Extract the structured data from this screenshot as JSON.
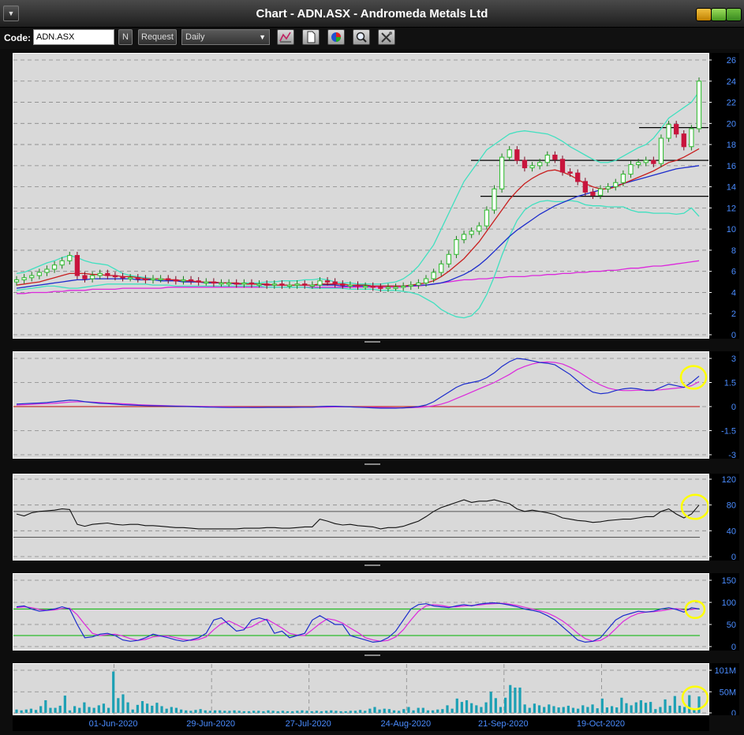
{
  "window": {
    "title": "Chart - ADN.ASX - Andromeda Metals Ltd"
  },
  "toolbar": {
    "code_label": "Code:",
    "code_value": "ADN.ASX",
    "n_button": "N",
    "request_button": "Request",
    "period_selected": "Daily",
    "tool_icons": [
      "chart-settings-icon",
      "document-icon",
      "color-palette-icon",
      "zoom-icon",
      "tools-icon"
    ]
  },
  "colors": {
    "panel_bg": "#d9d9d9",
    "up_candle": "#38c038",
    "down_candle": "#c8143c",
    "upper_band": "#40e0c0",
    "ma_short": "#c81e1e",
    "ma_mid": "#1c2ccc",
    "ma_long": "#dc28dc",
    "signal_line": "#c83232",
    "volume_bar": "#1ca0b4",
    "highlight_circle": "#ffff00",
    "level_green": "#00b400"
  },
  "chart_data": [
    {
      "type": "candlestick",
      "panel": "price",
      "y_ticks": [
        "26",
        "24",
        "22",
        "20",
        "18",
        "16",
        "14",
        "12",
        "10",
        "8",
        "6",
        "4",
        "2",
        "0"
      ],
      "ylim": [
        0,
        26
      ],
      "horizontal_levels": [
        19.6,
        16.5,
        13.1
      ],
      "close": [
        5.2,
        5.4,
        5.6,
        5.9,
        6.2,
        6.6,
        7.0,
        7.5,
        5.6,
        5.3,
        5.6,
        5.8,
        5.6,
        5.5,
        5.4,
        5.4,
        5.3,
        5.2,
        5.3,
        5.3,
        5.2,
        5.1,
        5.2,
        5.1,
        5.0,
        5.0,
        4.9,
        4.9,
        4.9,
        4.8,
        4.9,
        4.8,
        4.8,
        4.7,
        4.8,
        4.7,
        4.7,
        4.8,
        4.7,
        4.7,
        5.1,
        5.0,
        4.8,
        4.7,
        4.7,
        4.6,
        4.6,
        4.5,
        4.4,
        4.5,
        4.5,
        4.6,
        4.7,
        4.9,
        5.3,
        5.9,
        6.7,
        7.6,
        9.0,
        9.5,
        9.8,
        10.3,
        11.8,
        13.8,
        16.8,
        17.5,
        16.5,
        15.8,
        16.0,
        16.3,
        17.0,
        16.6,
        15.4,
        15.3,
        14.5,
        13.5,
        13.2,
        13.8,
        14.0,
        14.4,
        15.2,
        16.1,
        16.3,
        16.5,
        16.2,
        18.6,
        19.9,
        19.0,
        17.8,
        19.5,
        24.0
      ],
      "upper_band": [
        5.8,
        5.9,
        6.2,
        6.5,
        6.8,
        7.0,
        7.3,
        7.5,
        7.3,
        7.0,
        6.8,
        6.7,
        6.6,
        6.2,
        5.8,
        5.6,
        5.5,
        5.4,
        5.3,
        5.3,
        5.2,
        5.1,
        5.1,
        5.0,
        5.0,
        5.0,
        4.9,
        4.9,
        4.9,
        4.8,
        4.9,
        4.9,
        4.9,
        5.0,
        5.0,
        5.1,
        5.1,
        5.1,
        5.2,
        5.2,
        5.3,
        5.2,
        5.0,
        4.9,
        4.9,
        4.8,
        4.8,
        4.8,
        4.8,
        4.9,
        5.0,
        5.3,
        5.8,
        6.5,
        7.5,
        8.5,
        10.0,
        11.5,
        13.0,
        14.5,
        15.5,
        16.5,
        17.5,
        18.0,
        18.5,
        19.0,
        19.2,
        19.3,
        19.2,
        19.1,
        19.0,
        18.7,
        18.3,
        17.8,
        17.4,
        17.0,
        16.6,
        16.3,
        16.3,
        16.5,
        16.9,
        17.3,
        17.7,
        18.0,
        18.6,
        19.5,
        20.5,
        21.0,
        21.5,
        22.0,
        23.0
      ],
      "lower_band": [
        4.2,
        4.3,
        4.4,
        4.5,
        4.6,
        4.6,
        4.5,
        4.4,
        4.4,
        4.5,
        4.6,
        4.7,
        4.8,
        4.8,
        4.8,
        4.8,
        4.8,
        4.8,
        4.7,
        4.7,
        4.7,
        4.6,
        4.6,
        4.6,
        4.6,
        4.6,
        4.6,
        4.6,
        4.6,
        4.6,
        4.6,
        4.6,
        4.6,
        4.5,
        4.5,
        4.5,
        4.5,
        4.5,
        4.5,
        4.4,
        4.4,
        4.4,
        4.4,
        4.4,
        4.3,
        4.3,
        4.3,
        4.3,
        4.2,
        4.2,
        4.2,
        4.1,
        4.0,
        3.8,
        3.4,
        3.0,
        2.4,
        2.0,
        1.7,
        1.6,
        1.8,
        2.5,
        3.8,
        5.5,
        7.5,
        9.3,
        10.8,
        11.8,
        12.3,
        12.6,
        12.7,
        12.6,
        12.6,
        12.7,
        12.6,
        12.3,
        12.2,
        12.2,
        12.1,
        12.1,
        12.1,
        11.8,
        11.6,
        11.6,
        11.5,
        11.5,
        11.5,
        11.4,
        11.5,
        12.0,
        11.2
      ],
      "ma_short": [
        4.7,
        4.8,
        4.9,
        5.0,
        5.2,
        5.4,
        5.6,
        5.8,
        5.8,
        5.8,
        5.7,
        5.7,
        5.6,
        5.6,
        5.5,
        5.5,
        5.4,
        5.3,
        5.3,
        5.3,
        5.2,
        5.2,
        5.1,
        5.1,
        5.0,
        5.0,
        5.0,
        4.9,
        4.9,
        4.9,
        4.8,
        4.8,
        4.8,
        4.8,
        4.7,
        4.7,
        4.7,
        4.7,
        4.7,
        4.7,
        4.8,
        4.8,
        4.8,
        4.8,
        4.7,
        4.7,
        4.7,
        4.6,
        4.6,
        4.6,
        4.6,
        4.6,
        4.7,
        4.8,
        4.9,
        5.1,
        5.5,
        6.0,
        6.6,
        7.2,
        8.0,
        8.8,
        9.8,
        10.8,
        11.8,
        12.8,
        13.6,
        14.3,
        14.8,
        15.2,
        15.5,
        15.6,
        15.4,
        15.1,
        14.7,
        14.3,
        14.0,
        13.8,
        13.8,
        14.0,
        14.3,
        14.6,
        14.9,
        15.2,
        15.5,
        15.9,
        16.3,
        16.5,
        16.8,
        17.2,
        17.6
      ],
      "ma_mid": [
        4.4,
        4.5,
        4.6,
        4.7,
        4.8,
        4.9,
        5.0,
        5.1,
        5.2,
        5.2,
        5.3,
        5.3,
        5.3,
        5.3,
        5.3,
        5.3,
        5.2,
        5.2,
        5.2,
        5.1,
        5.1,
        5.1,
        5.0,
        5.0,
        5.0,
        4.9,
        4.9,
        4.9,
        4.9,
        4.8,
        4.8,
        4.8,
        4.8,
        4.7,
        4.7,
        4.7,
        4.7,
        4.7,
        4.7,
        4.7,
        4.7,
        4.7,
        4.7,
        4.6,
        4.6,
        4.6,
        4.6,
        4.6,
        4.6,
        4.6,
        4.6,
        4.6,
        4.6,
        4.7,
        4.7,
        4.8,
        4.9,
        5.1,
        5.4,
        5.7,
        6.1,
        6.6,
        7.2,
        7.9,
        8.6,
        9.3,
        9.9,
        10.4,
        10.9,
        11.4,
        11.8,
        12.2,
        12.5,
        12.8,
        13.1,
        13.3,
        13.5,
        13.7,
        13.9,
        14.1,
        14.3,
        14.5,
        14.7,
        14.9,
        15.1,
        15.3,
        15.5,
        15.7,
        15.8,
        15.9,
        16.0
      ],
      "ma_long": [
        3.9,
        3.9,
        4.0,
        4.0,
        4.0,
        4.1,
        4.1,
        4.2,
        4.2,
        4.2,
        4.3,
        4.3,
        4.3,
        4.3,
        4.4,
        4.4,
        4.4,
        4.4,
        4.4,
        4.4,
        4.5,
        4.5,
        4.5,
        4.5,
        4.5,
        4.5,
        4.5,
        4.5,
        4.5,
        4.5,
        4.5,
        4.5,
        4.5,
        4.5,
        4.5,
        4.5,
        4.5,
        4.5,
        4.5,
        4.5,
        4.5,
        4.5,
        4.5,
        4.5,
        4.5,
        4.5,
        4.5,
        4.5,
        4.5,
        4.5,
        4.5,
        4.5,
        4.6,
        4.6,
        4.7,
        4.8,
        4.9,
        5.0,
        5.1,
        5.2,
        5.2,
        5.3,
        5.3,
        5.4,
        5.4,
        5.5,
        5.5,
        5.5,
        5.6,
        5.6,
        5.7,
        5.7,
        5.8,
        5.8,
        5.9,
        5.9,
        6.0,
        6.0,
        6.1,
        6.1,
        6.2,
        6.3,
        6.3,
        6.4,
        6.5,
        6.5,
        6.6,
        6.7,
        6.8,
        6.9,
        7.0
      ]
    },
    {
      "type": "line",
      "panel": "macd",
      "y_ticks": [
        "3",
        "1.5",
        "0",
        "-1.5",
        "-3"
      ],
      "ylim": [
        -3,
        3
      ],
      "macd": [
        0.15,
        0.18,
        0.2,
        0.22,
        0.25,
        0.3,
        0.35,
        0.4,
        0.38,
        0.3,
        0.25,
        0.2,
        0.18,
        0.15,
        0.12,
        0.1,
        0.08,
        0.06,
        0.05,
        0.04,
        0.03,
        0.02,
        0.01,
        0.0,
        -0.02,
        -0.03,
        -0.04,
        -0.05,
        -0.06,
        -0.06,
        -0.06,
        -0.06,
        -0.06,
        -0.05,
        -0.05,
        -0.05,
        -0.05,
        -0.04,
        -0.04,
        -0.04,
        0.0,
        0.02,
        0.02,
        0.0,
        -0.02,
        -0.04,
        -0.06,
        -0.08,
        -0.1,
        -0.1,
        -0.1,
        -0.08,
        -0.05,
        0.0,
        0.1,
        0.3,
        0.6,
        0.9,
        1.2,
        1.4,
        1.5,
        1.6,
        1.8,
        2.1,
        2.5,
        2.8,
        3.0,
        2.95,
        2.85,
        2.75,
        2.7,
        2.6,
        2.3,
        2.0,
        1.6,
        1.2,
        0.9,
        0.8,
        0.85,
        1.0,
        1.1,
        1.15,
        1.1,
        1.0,
        1.0,
        1.2,
        1.4,
        1.3,
        1.2,
        1.5,
        1.9
      ],
      "signal": [
        0.1,
        0.12,
        0.14,
        0.16,
        0.18,
        0.2,
        0.24,
        0.28,
        0.3,
        0.3,
        0.28,
        0.25,
        0.22,
        0.2,
        0.17,
        0.15,
        0.12,
        0.1,
        0.08,
        0.07,
        0.05,
        0.04,
        0.03,
        0.02,
        0.01,
        0.0,
        -0.01,
        -0.02,
        -0.03,
        -0.04,
        -0.04,
        -0.05,
        -0.05,
        -0.05,
        -0.05,
        -0.05,
        -0.05,
        -0.05,
        -0.04,
        -0.04,
        -0.04,
        -0.03,
        -0.02,
        -0.02,
        -0.02,
        -0.03,
        -0.04,
        -0.05,
        -0.06,
        -0.07,
        -0.08,
        -0.08,
        -0.07,
        -0.05,
        -0.02,
        0.05,
        0.15,
        0.3,
        0.5,
        0.7,
        0.9,
        1.1,
        1.3,
        1.5,
        1.75,
        2.0,
        2.3,
        2.5,
        2.65,
        2.75,
        2.78,
        2.75,
        2.65,
        2.45,
        2.2,
        1.9,
        1.6,
        1.35,
        1.15,
        1.05,
        1.0,
        1.0,
        1.02,
        1.03,
        1.03,
        1.05,
        1.1,
        1.15,
        1.2,
        1.3,
        1.55
      ],
      "zero_line": 0
    },
    {
      "type": "line",
      "panel": "rsi",
      "y_ticks": [
        "120",
        "80",
        "40",
        "0"
      ],
      "ylim": [
        0,
        120
      ],
      "reference_levels": [
        70,
        30
      ],
      "values": [
        66,
        63,
        68,
        70,
        71,
        72,
        74,
        73,
        50,
        47,
        50,
        51,
        52,
        50,
        49,
        50,
        50,
        48,
        48,
        47,
        46,
        45,
        45,
        44,
        43,
        43,
        43,
        43,
        43,
        43,
        44,
        44,
        44,
        45,
        45,
        44,
        44,
        45,
        46,
        46,
        58,
        55,
        51,
        49,
        50,
        48,
        47,
        46,
        43,
        45,
        45,
        47,
        51,
        55,
        62,
        70,
        76,
        80,
        84,
        88,
        84,
        86,
        86,
        88,
        85,
        82,
        74,
        70,
        72,
        70,
        68,
        65,
        60,
        58,
        56,
        55,
        53,
        54,
        56,
        57,
        58,
        58,
        60,
        62,
        62,
        70,
        74,
        66,
        60,
        66,
        80
      ]
    },
    {
      "type": "line",
      "panel": "stochastic",
      "y_ticks": [
        "150",
        "100",
        "50",
        "0"
      ],
      "ylim": [
        0,
        150
      ],
      "reference_levels": [
        85,
        25
      ],
      "k": [
        90,
        92,
        85,
        80,
        82,
        85,
        90,
        85,
        50,
        20,
        22,
        28,
        30,
        25,
        15,
        12,
        14,
        20,
        28,
        24,
        20,
        15,
        12,
        15,
        20,
        30,
        60,
        65,
        50,
        35,
        38,
        60,
        65,
        60,
        30,
        35,
        20,
        25,
        30,
        60,
        70,
        60,
        50,
        50,
        25,
        20,
        15,
        10,
        12,
        20,
        35,
        60,
        85,
        95,
        97,
        92,
        90,
        88,
        92,
        95,
        92,
        96,
        98,
        99,
        97,
        94,
        90,
        85,
        82,
        78,
        70,
        60,
        45,
        30,
        15,
        10,
        12,
        20,
        40,
        60,
        70,
        75,
        80,
        78,
        80,
        85,
        88,
        84,
        78,
        88,
        85
      ],
      "d": [
        88,
        90,
        88,
        84,
        82,
        83,
        86,
        87,
        72,
        50,
        30,
        25,
        27,
        28,
        24,
        18,
        14,
        16,
        22,
        24,
        24,
        20,
        16,
        14,
        16,
        22,
        38,
        52,
        58,
        50,
        41,
        45,
        55,
        62,
        52,
        42,
        30,
        26,
        25,
        38,
        52,
        63,
        60,
        53,
        42,
        32,
        20,
        15,
        12,
        14,
        22,
        38,
        60,
        80,
        92,
        95,
        93,
        90,
        90,
        92,
        93,
        94,
        96,
        97,
        98,
        96,
        93,
        89,
        85,
        81,
        76,
        68,
        58,
        45,
        30,
        18,
        12,
        14,
        24,
        40,
        57,
        68,
        75,
        78,
        79,
        81,
        84,
        86,
        83,
        84,
        86
      ]
    },
    {
      "type": "bar",
      "panel": "volume",
      "y_ticks": [
        "101M",
        "50M",
        "0"
      ],
      "ylim": [
        0,
        101
      ],
      "x_ticks": [
        "01-Jun-2020",
        "29-Jun-2020",
        "27-Jul-2020",
        "24-Aug-2020",
        "21-Sep-2020",
        "19-Oct-2020"
      ],
      "x_tick_indices": [
        20,
        40,
        60,
        80,
        100,
        120
      ],
      "values": [
        8,
        6,
        8,
        10,
        7,
        16,
        30,
        12,
        12,
        17,
        41,
        6,
        16,
        12,
        25,
        14,
        12,
        18,
        22,
        12,
        98,
        35,
        44,
        25,
        8,
        19,
        28,
        22,
        17,
        24,
        16,
        10,
        14,
        12,
        8,
        6,
        5,
        7,
        9,
        6,
        5,
        6,
        6,
        5,
        5,
        6,
        5,
        4,
        4,
        5,
        5,
        4,
        6,
        5,
        4,
        5,
        4,
        4,
        5,
        6,
        5,
        4,
        5,
        4,
        5,
        6,
        5,
        4,
        4,
        5,
        5,
        7,
        5,
        10,
        14,
        8,
        10,
        9,
        6,
        5,
        9,
        14,
        6,
        12,
        12,
        6,
        6,
        8,
        9,
        18,
        10,
        34,
        26,
        30,
        23,
        18,
        14,
        25,
        50,
        35,
        14,
        36,
        66,
        60,
        60,
        20,
        12,
        22,
        18,
        14,
        20,
        16,
        13,
        14,
        17,
        12,
        10,
        18,
        14,
        20,
        11,
        34,
        13,
        16,
        13,
        36,
        23,
        18,
        25,
        30,
        24,
        26,
        9,
        14,
        32,
        17,
        40,
        17,
        14,
        42,
        10,
        39
      ]
    }
  ]
}
